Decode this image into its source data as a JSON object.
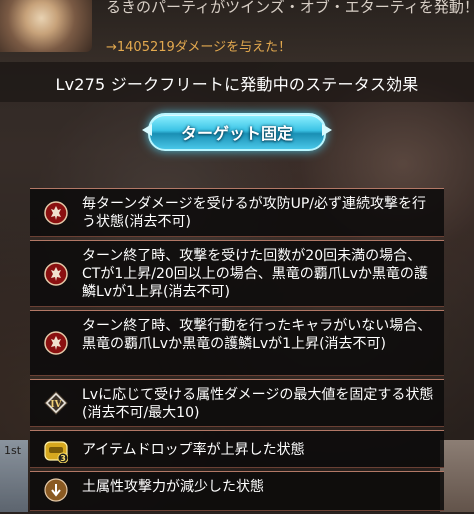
{
  "notification": {
    "line1": "るきのパーティがツインズ・オブ・エターティを発動！",
    "line2": "→1405219ダメージを与えた！"
  },
  "header": {
    "title": "Lv275 ジークフリートに発動中のステータス効果"
  },
  "target_button": {
    "label": "ターゲット固定"
  },
  "side": {
    "left_label": "1st"
  },
  "statuses": [
    {
      "icon": "dragon-crest-icon",
      "text": "毎ターンダメージを受けるが攻防UP/必ず連続攻撃を行う状態(消去不可)"
    },
    {
      "icon": "dragon-crest-icon",
      "text": "ターン終了時、攻撃を受けた回数が20回未満の場合、CTが1上昇/20回以上の場合、黒竜の覇爪Lvか黒竜の護鱗Lvが1上昇(消去不可)"
    },
    {
      "icon": "dragon-crest-icon",
      "text": "ターン終了時、攻撃行動を行ったキャラがいない場合、黒竜の覇爪Lvか黒竜の護鱗Lvが1上昇(消去不可)"
    },
    {
      "icon": "damage-cap-iv-icon",
      "badge": "IV",
      "text": "Lvに応じて受ける属性ダメージの最大値を固定する状態(消去不可/最大10)"
    },
    {
      "icon": "item-drop-up-icon",
      "badge": "3",
      "text": "アイテムドロップ率が上昇した状態"
    },
    {
      "icon": "earth-attack-down-icon",
      "text": "土属性攻撃力が減少した状態"
    }
  ]
}
